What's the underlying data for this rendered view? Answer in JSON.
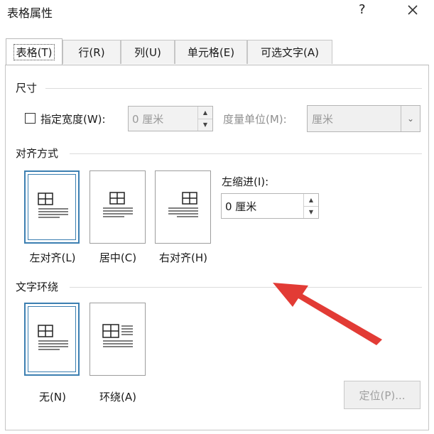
{
  "dialog": {
    "title": "表格属性",
    "help": "?",
    "close": "×"
  },
  "tabs": [
    {
      "label": "表格(T)",
      "active": true
    },
    {
      "label": "行(R)",
      "active": false
    },
    {
      "label": "列(U)",
      "active": false
    },
    {
      "label": "单元格(E)",
      "active": false
    },
    {
      "label": "可选文字(A)",
      "active": false
    }
  ],
  "size": {
    "section": "尺寸",
    "specify_width_label": "指定宽度(W):",
    "specify_width_checked": false,
    "width_value": "0 厘米",
    "unit_label": "度量单位(M):",
    "unit_value": "厘米"
  },
  "alignment": {
    "section": "对齐方式",
    "options": [
      "左对齐(L)",
      "居中(C)",
      "右对齐(H)"
    ],
    "selected": "左对齐(L)",
    "indent_label": "左缩进(I):",
    "indent_value": "0 厘米"
  },
  "wrap": {
    "section": "文字环绕",
    "options": [
      "无(N)",
      "环绕(A)"
    ],
    "selected": "无(N)"
  },
  "position_button": "定位(P)...",
  "annotation": {
    "color": "#e23b35",
    "icon": "red-arrow"
  }
}
